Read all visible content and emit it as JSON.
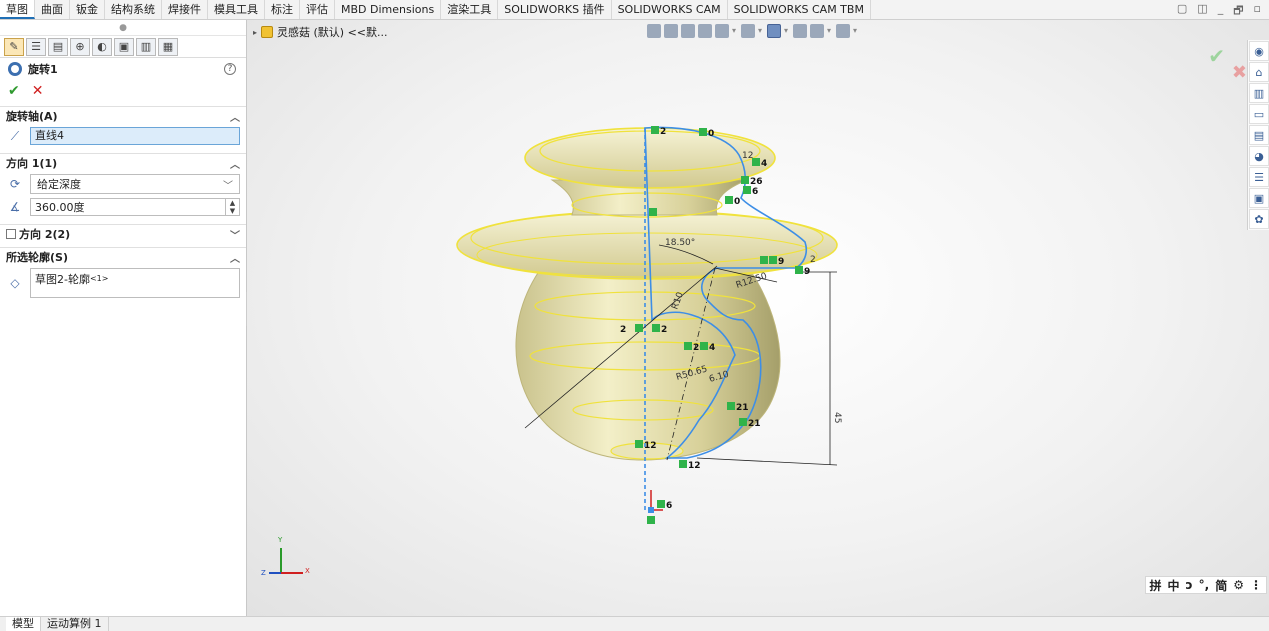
{
  "top_tabs": [
    {
      "label": "草图",
      "active": true
    },
    {
      "label": "曲面"
    },
    {
      "label": "钣金"
    },
    {
      "label": "结构系统"
    },
    {
      "label": "焊接件"
    },
    {
      "label": "模具工具"
    },
    {
      "label": "标注"
    },
    {
      "label": "评估"
    },
    {
      "label": "MBD Dimensions"
    },
    {
      "label": "渲染工具"
    },
    {
      "label": "SOLIDWORKS 插件"
    },
    {
      "label": "SOLIDWORKS CAM"
    },
    {
      "label": "SOLIDWORKS CAM TBM"
    }
  ],
  "window_controls": [
    "▢",
    "◫",
    "_",
    "🗗",
    "▫"
  ],
  "property_manager": {
    "feature_title": "旋转1",
    "help": "?",
    "ok": "✔",
    "cancel": "✕",
    "axis_section": {
      "title": "旋转轴(A)",
      "value": "直线4"
    },
    "dir1_section": {
      "title": "方向 1(1)",
      "end_condition": "给定深度",
      "angle": "360.00度"
    },
    "dir2_section": {
      "title": "方向 2(2)"
    },
    "contours_section": {
      "title": "所选轮廓(S)",
      "item": "草图2-轮廓",
      "item_suffix": "<1>"
    }
  },
  "viewport": {
    "tree_item": "灵感菇 (默认) <<默...",
    "sketch_labels": {
      "dim_angle": "18.50°",
      "dim_r1": "R12.50",
      "dim_r2": "R50.65",
      "dim_r3": "R10",
      "dim_r4": "6.10",
      "dim_vertical": "45",
      "dim_small": "2",
      "dim_tiny": "12"
    },
    "relation_labels": [
      "2",
      "0",
      "4",
      "26",
      "6",
      "0",
      "9",
      "9",
      "2",
      "2",
      "26",
      "4",
      "21",
      "21",
      "12",
      "12",
      "6"
    ],
    "triad": {
      "x": "X",
      "y": "Y",
      "z": "Z"
    }
  },
  "ime_bar": [
    "拼",
    "中",
    "ɔ",
    "°,",
    "简",
    "⚙",
    "⋮"
  ],
  "bottom_tabs": [
    {
      "label": "模型",
      "active": true
    },
    {
      "label": "运动算例 1"
    }
  ]
}
